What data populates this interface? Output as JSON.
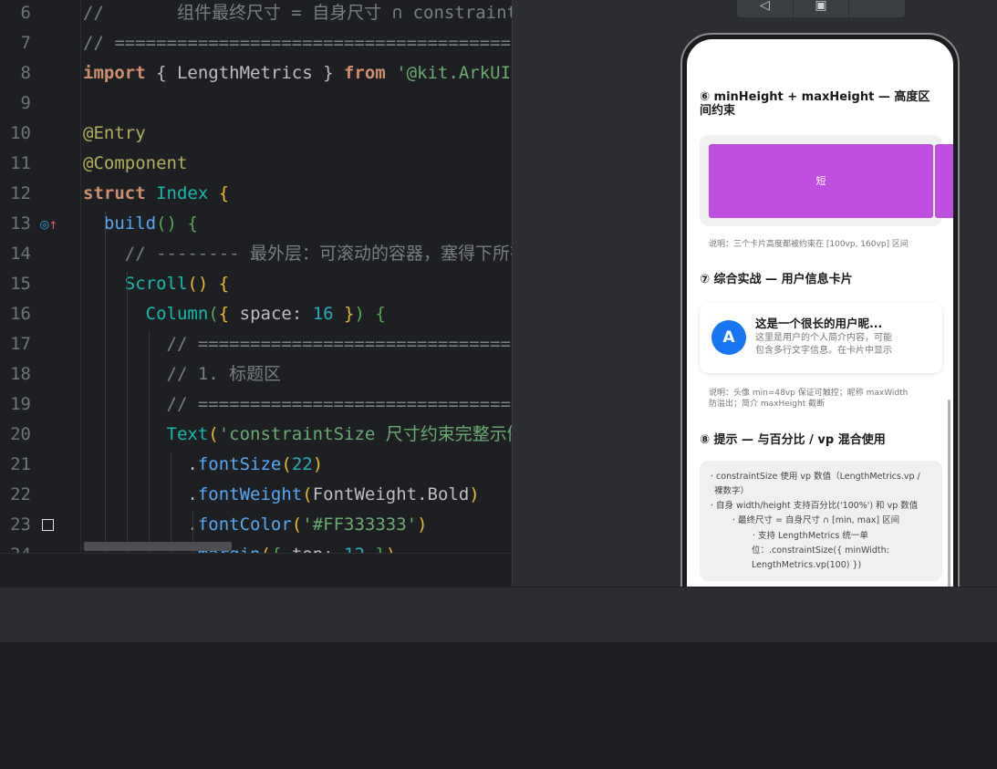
{
  "editor": {
    "lines": [
      {
        "n": "6",
        "parts": [
          [
            "com",
            "//       组件最终尺寸 = 自身尺寸 ∩ constraintSize"
          ]
        ]
      },
      {
        "n": "7",
        "parts": [
          [
            "com",
            "// ====================================================="
          ]
        ]
      },
      {
        "n": "8",
        "parts": [
          [
            "kw",
            "import"
          ],
          [
            "def",
            " { LengthMetrics } "
          ],
          [
            "kw",
            "from"
          ],
          [
            "def",
            " "
          ],
          [
            "str",
            "'@kit.ArkUI'"
          ]
        ]
      },
      {
        "n": "9",
        "parts": []
      },
      {
        "n": "10",
        "parts": [
          [
            "dec",
            "@Entry"
          ]
        ]
      },
      {
        "n": "11",
        "parts": [
          [
            "dec",
            "@Component"
          ]
        ]
      },
      {
        "n": "12",
        "parts": [
          [
            "kw",
            "struct"
          ],
          [
            "def",
            " "
          ],
          [
            "cls",
            "Index"
          ],
          [
            "def",
            " "
          ],
          [
            "br1",
            "{"
          ]
        ]
      },
      {
        "n": "13",
        "parts": [
          [
            "def",
            "  "
          ],
          [
            "fn",
            "build"
          ],
          [
            "br2",
            "()"
          ],
          [
            "def",
            " "
          ],
          [
            "br2",
            "{"
          ]
        ]
      },
      {
        "n": "14",
        "parts": [
          [
            "com",
            "    // -------- 最外层：可滚动的容器，塞得下所有内容"
          ]
        ]
      },
      {
        "n": "15",
        "parts": [
          [
            "def",
            "    "
          ],
          [
            "cls",
            "Scroll"
          ],
          [
            "br1",
            "()"
          ],
          [
            "def",
            " "
          ],
          [
            "br1",
            "{"
          ]
        ]
      },
      {
        "n": "16",
        "parts": [
          [
            "def",
            "      "
          ],
          [
            "cls",
            "Column"
          ],
          [
            "br2",
            "("
          ],
          [
            "br1",
            "{"
          ],
          [
            "def",
            " space: "
          ],
          [
            "num",
            "16"
          ],
          [
            "def",
            " "
          ],
          [
            "br1",
            "}"
          ],
          [
            "br2",
            ")"
          ],
          [
            "def",
            " "
          ],
          [
            "br2",
            "{"
          ]
        ]
      },
      {
        "n": "17",
        "parts": [
          [
            "com",
            "        // ================================================"
          ]
        ]
      },
      {
        "n": "18",
        "parts": [
          [
            "com",
            "        // 1. 标题区"
          ]
        ]
      },
      {
        "n": "19",
        "parts": [
          [
            "com",
            "        // ================================================"
          ]
        ]
      },
      {
        "n": "20",
        "parts": [
          [
            "def",
            "        "
          ],
          [
            "cls",
            "Text"
          ],
          [
            "br1",
            "("
          ],
          [
            "str",
            "'constraintSize 尺寸约束完整示例'"
          ],
          [
            "br1",
            ")"
          ]
        ]
      },
      {
        "n": "21",
        "parts": [
          [
            "def",
            "          ."
          ],
          [
            "fn",
            "fontSize"
          ],
          [
            "br1",
            "("
          ],
          [
            "num",
            "22"
          ],
          [
            "br1",
            ")"
          ]
        ]
      },
      {
        "n": "22",
        "parts": [
          [
            "def",
            "          ."
          ],
          [
            "fn",
            "fontWeight"
          ],
          [
            "br1",
            "("
          ],
          [
            "def",
            "FontWeight."
          ],
          [
            "def",
            "Bold"
          ],
          [
            "br1",
            ")"
          ]
        ]
      },
      {
        "n": "23",
        "parts": [
          [
            "def",
            "          ."
          ],
          [
            "fn",
            "fontColor"
          ],
          [
            "br1",
            "("
          ],
          [
            "str",
            "'#FF333333'"
          ],
          [
            "br1",
            ")"
          ]
        ]
      },
      {
        "n": "24",
        "parts": [
          [
            "def",
            "          ."
          ],
          [
            "fn",
            "margin"
          ],
          [
            "br1",
            "("
          ],
          [
            "br2",
            "{"
          ],
          [
            "def",
            " top: "
          ],
          [
            "num",
            "12"
          ],
          [
            "def",
            " "
          ],
          [
            "br2",
            "}"
          ],
          [
            "br1",
            ")"
          ]
        ]
      }
    ],
    "gutter_icon_13": "◎↑"
  },
  "preview": {
    "toolbar": [
      "◁",
      "▣",
      ""
    ],
    "section6_title": "⑥ minHeight + maxHeight — 高度区间约束",
    "bar_label": "短",
    "section6_note": "说明：三个卡片高度都被约束在 [100vp, 160vp] 区间",
    "section7_title": "⑦ 综合实战 — 用户信息卡片",
    "user_avatar": "A",
    "user_name": "这是一个很长的用户昵...",
    "user_bio": "这里是用户的个人简介内容，可能包含多行文字信息。在卡片中显示",
    "section7_note": "说明：头像 min=48vp 保证可触控；昵称 maxWidth 防溢出；简介 maxHeight 截断",
    "section8_title": "⑧ 提示 — 与百分比 / vp 混合使用",
    "tips": [
      "· constraintSize 使用 vp 数值（LengthMetrics.vp /",
      "裸数字）",
      "· 自身 width/height 支持百分比('100%') 和 vp 数值",
      "· 最终尺寸 = 自身尺寸 ∩ [min, max] 区间",
      "· 支持 LengthMetrics 统一单",
      "位：.constraintSize({ minWidth:",
      "LengthMetrics.vp(100) })"
    ]
  },
  "colors": {
    "editor_bg": "#1e1f22",
    "panel_bg": "#2b2d30",
    "bar_purple": "#c04ee0",
    "avatar_blue": "#1976f2"
  }
}
